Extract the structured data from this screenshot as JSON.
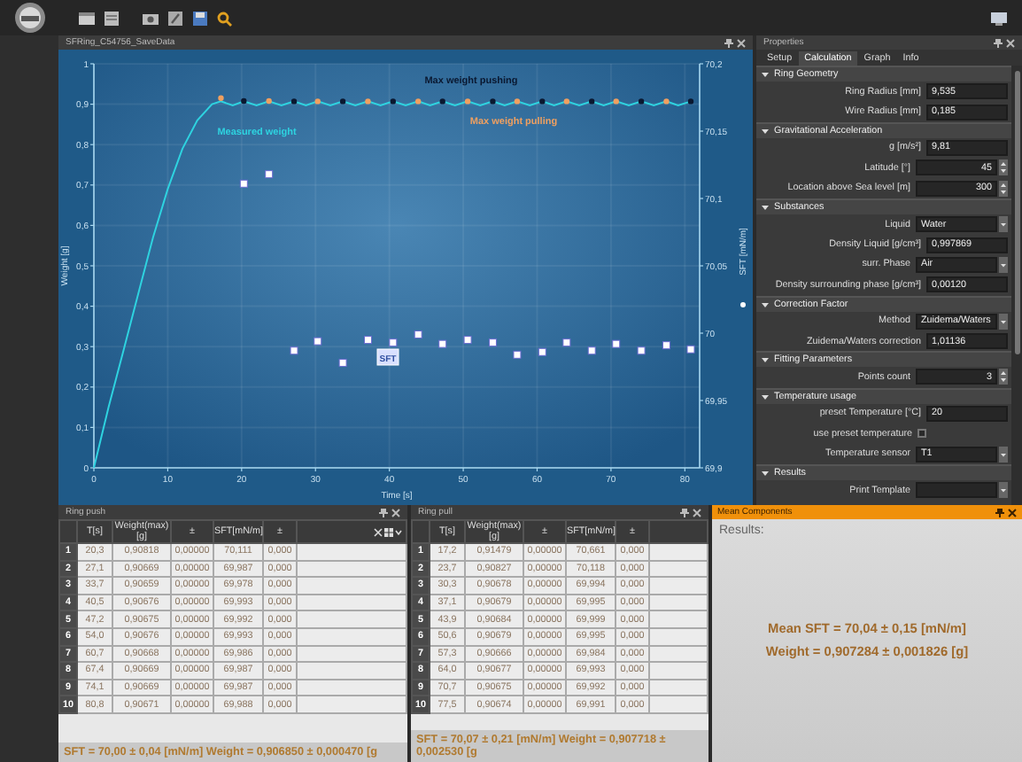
{
  "chart_window": {
    "title": "SFRing_C54756_SaveData",
    "chart_data": {
      "type": "line",
      "xlabel": "Time [s]",
      "ylabel": "Weight [g]",
      "y2label": "SFT [mN/m]",
      "xlim": [
        0,
        82
      ],
      "ylim": [
        0,
        1
      ],
      "y2lim": [
        69.9,
        70.2
      ],
      "xticks": [
        0,
        10,
        20,
        30,
        40,
        50,
        60,
        70,
        80
      ],
      "yticks": [
        {
          "value": 0,
          "label": "0"
        },
        {
          "value": 0.1,
          "label": "0,1"
        },
        {
          "value": 0.2,
          "label": "0,2"
        },
        {
          "value": 0.3,
          "label": "0,3"
        },
        {
          "value": 0.4,
          "label": "0,4"
        },
        {
          "value": 0.5,
          "label": "0,5"
        },
        {
          "value": 0.6,
          "label": "0,6"
        },
        {
          "value": 0.7,
          "label": "0,7"
        },
        {
          "value": 0.8,
          "label": "0,8"
        },
        {
          "value": 0.9,
          "label": "0,9"
        },
        {
          "value": 1,
          "label": "1"
        }
      ],
      "y2ticks": [
        {
          "value": 69.9,
          "label": "69,9"
        },
        {
          "value": 69.95,
          "label": "69,95"
        },
        {
          "value": 70,
          "label": "70"
        },
        {
          "value": 70.05,
          "label": "70,05"
        },
        {
          "value": 70.1,
          "label": "70,1"
        },
        {
          "value": 70.15,
          "label": "70,15"
        },
        {
          "value": 70.2,
          "label": "70,2"
        }
      ],
      "series": [
        {
          "name": "Measured weight",
          "type": "line",
          "color": "#2ed3e0",
          "x": [
            0,
            2,
            4,
            6,
            8,
            10,
            12,
            14,
            16,
            17.2,
            18.8,
            20.3,
            22,
            23.7,
            25.4,
            27.1,
            28.7,
            30.3,
            32,
            33.7,
            35.4,
            37.1,
            38.8,
            40.5,
            42.2,
            43.9,
            45.5,
            47.2,
            48.9,
            50.6,
            52.3,
            54,
            55.6,
            57.3,
            59,
            60.7,
            62.3,
            64,
            65.7,
            67.4,
            69,
            70.7,
            72.4,
            74.1,
            75.8,
            77.5,
            79.1,
            80.8
          ],
          "values": [
            0,
            0.15,
            0.29,
            0.43,
            0.57,
            0.69,
            0.79,
            0.86,
            0.9,
            0.907,
            0.897,
            0.907,
            0.897,
            0.907,
            0.897,
            0.907,
            0.897,
            0.907,
            0.897,
            0.907,
            0.897,
            0.907,
            0.897,
            0.907,
            0.897,
            0.907,
            0.897,
            0.907,
            0.897,
            0.907,
            0.897,
            0.907,
            0.897,
            0.907,
            0.897,
            0.907,
            0.897,
            0.907,
            0.897,
            0.907,
            0.897,
            0.907,
            0.897,
            0.907,
            0.897,
            0.907,
            0.897,
            0.907
          ]
        },
        {
          "name": "Max weight pushing",
          "type": "scatter",
          "color": "#0a1830",
          "x": [
            20.3,
            27.1,
            33.7,
            40.5,
            47.2,
            54,
            60.7,
            67.4,
            74.1,
            80.8
          ],
          "values": [
            0.908,
            0.907,
            0.907,
            0.907,
            0.907,
            0.907,
            0.907,
            0.907,
            0.907,
            0.907
          ]
        },
        {
          "name": "Max weight pulling",
          "type": "scatter",
          "color": "#f0a060",
          "x": [
            17.2,
            23.7,
            30.3,
            37.1,
            43.9,
            50.6,
            57.3,
            64,
            70.7,
            77.5
          ],
          "values": [
            0.915,
            0.908,
            0.907,
            0.907,
            0.907,
            0.907,
            0.907,
            0.907,
            0.907,
            0.907
          ]
        },
        {
          "name": "SFT",
          "type": "scatter",
          "axis": "y2",
          "color": "#ffffff",
          "x": [
            20.3,
            23.7,
            27.1,
            30.3,
            33.7,
            37.1,
            40.5,
            43.9,
            47.2,
            50.6,
            54,
            57.3,
            60.7,
            64,
            67.4,
            70.7,
            74.1,
            77.5,
            80.8
          ],
          "values": [
            70.111,
            70.118,
            69.987,
            69.994,
            69.978,
            69.995,
            69.993,
            69.999,
            69.992,
            69.995,
            69.993,
            69.984,
            69.986,
            69.993,
            69.987,
            69.992,
            69.987,
            69.991,
            69.988
          ]
        }
      ],
      "grid": true
    }
  },
  "properties": {
    "title": "Properties",
    "tabs": [
      {
        "label": "Setup",
        "selected": false
      },
      {
        "label": "Calculation",
        "selected": true
      },
      {
        "label": "Graph",
        "selected": false
      },
      {
        "label": "Info",
        "selected": false
      }
    ],
    "sections": [
      {
        "title": "Ring Geometry",
        "expanded": true,
        "rows": [
          {
            "kind": "text",
            "label": "Ring Radius [mm]",
            "value": "9,535"
          },
          {
            "kind": "text",
            "label": "Wire Radius [mm]",
            "value": "0,185"
          }
        ]
      },
      {
        "title": "Gravitational Acceleration",
        "expanded": true,
        "rows": [
          {
            "kind": "text",
            "label": "g [m/s²]",
            "value": "9,81"
          },
          {
            "kind": "spinner",
            "label": "Latitude [°]",
            "value": "45"
          },
          {
            "kind": "spinner",
            "label": "Location above Sea level [m]",
            "value": "300"
          }
        ]
      },
      {
        "title": "Substances",
        "expanded": true,
        "rows": [
          {
            "kind": "dropdown",
            "label": "Liquid",
            "value": "Water"
          },
          {
            "kind": "text",
            "label": "Density Liquid [g/cm³]",
            "value": "0,997869"
          },
          {
            "kind": "dropdown",
            "label": "surr. Phase",
            "value": "Air"
          },
          {
            "kind": "text",
            "label": "Density surrounding phase [g/cm³]",
            "value": "0,00120"
          }
        ]
      },
      {
        "title": "Correction Factor",
        "expanded": true,
        "rows": [
          {
            "kind": "dropdown",
            "label": "Method",
            "value": "Zuidema/Waters"
          },
          {
            "kind": "text",
            "label": "Zuidema/Waters correction",
            "value": "1,01136"
          }
        ]
      },
      {
        "title": "Fitting Parameters",
        "expanded": true,
        "rows": [
          {
            "kind": "spinner",
            "label": "Points count",
            "value": "3"
          }
        ]
      },
      {
        "title": "Temperature usage",
        "expanded": true,
        "rows": [
          {
            "kind": "text",
            "label": "preset Temperature [°C]",
            "value": "20"
          },
          {
            "kind": "checkbox",
            "label": "use preset temperature",
            "checked": false
          },
          {
            "kind": "dropdown",
            "label": "Temperature sensor",
            "value": "T1"
          }
        ]
      },
      {
        "title": "Results",
        "expanded": true,
        "rows": [
          {
            "kind": "dropdown",
            "label": "Print Template"
          }
        ]
      }
    ]
  },
  "tables": [
    {
      "title": "Ring push",
      "columns": [
        "T[s]",
        "Weight(max)[g]",
        "±",
        "SFT[mN/m]",
        "±"
      ],
      "rows": [
        {
          "index": "1",
          "cells": [
            "20,3",
            "0,90818",
            "0,00000",
            "70,111",
            "0,000"
          ]
        },
        {
          "index": "2",
          "cells": [
            "27,1",
            "0,90669",
            "0,00000",
            "69,987",
            "0,000"
          ]
        },
        {
          "index": "3",
          "cells": [
            "33,7",
            "0,90659",
            "0,00000",
            "69,978",
            "0,000"
          ]
        },
        {
          "index": "4",
          "cells": [
            "40,5",
            "0,90676",
            "0,00000",
            "69,993",
            "0,000"
          ]
        },
        {
          "index": "5",
          "cells": [
            "47,2",
            "0,90675",
            "0,00000",
            "69,992",
            "0,000"
          ]
        },
        {
          "index": "6",
          "cells": [
            "54,0",
            "0,90676",
            "0,00000",
            "69,993",
            "0,000"
          ]
        },
        {
          "index": "7",
          "cells": [
            "60,7",
            "0,90668",
            "0,00000",
            "69,986",
            "0,000"
          ]
        },
        {
          "index": "8",
          "cells": [
            "67,4",
            "0,90669",
            "0,00000",
            "69,987",
            "0,000"
          ]
        },
        {
          "index": "9",
          "cells": [
            "74,1",
            "0,90669",
            "0,00000",
            "69,987",
            "0,000"
          ]
        },
        {
          "index": "10",
          "cells": [
            "80,8",
            "0,90671",
            "0,00000",
            "69,988",
            "0,000"
          ]
        }
      ],
      "summary": "SFT = 70,00 ± 0,04 [mN/m]  Weight = 0,906850 ± 0,000470 [g"
    },
    {
      "title": "Ring pull",
      "columns": [
        "T[s]",
        "Weight(max)[g]",
        "±",
        "SFT[mN/m]",
        "±"
      ],
      "rows": [
        {
          "index": "1",
          "cells": [
            "17,2",
            "0,91479",
            "0,00000",
            "70,661",
            "0,000"
          ]
        },
        {
          "index": "2",
          "cells": [
            "23,7",
            "0,90827",
            "0,00000",
            "70,118",
            "0,000"
          ]
        },
        {
          "index": "3",
          "cells": [
            "30,3",
            "0,90678",
            "0,00000",
            "69,994",
            "0,000"
          ]
        },
        {
          "index": "4",
          "cells": [
            "37,1",
            "0,90679",
            "0,00000",
            "69,995",
            "0,000"
          ]
        },
        {
          "index": "5",
          "cells": [
            "43,9",
            "0,90684",
            "0,00000",
            "69,999",
            "0,000"
          ]
        },
        {
          "index": "6",
          "cells": [
            "50,6",
            "0,90679",
            "0,00000",
            "69,995",
            "0,000"
          ]
        },
        {
          "index": "7",
          "cells": [
            "57,3",
            "0,90666",
            "0,00000",
            "69,984",
            "0,000"
          ]
        },
        {
          "index": "8",
          "cells": [
            "64,0",
            "0,90677",
            "0,00000",
            "69,993",
            "0,000"
          ]
        },
        {
          "index": "9",
          "cells": [
            "70,7",
            "0,90675",
            "0,00000",
            "69,992",
            "0,000"
          ]
        },
        {
          "index": "10",
          "cells": [
            "77,5",
            "0,90674",
            "0,00000",
            "69,991",
            "0,000"
          ]
        }
      ],
      "summary": "SFT = 70,07 ± 0,21 [mN/m]  Weight = 0,907718 ± 0,002530 [g"
    }
  ],
  "mean_components": {
    "title": "Mean Components",
    "heading": "Results:",
    "lines": [
      "Mean SFT = 70,04 ± 0,15 [mN/m]",
      "Weight = 0,907284 ± 0,001826 [g]"
    ]
  }
}
